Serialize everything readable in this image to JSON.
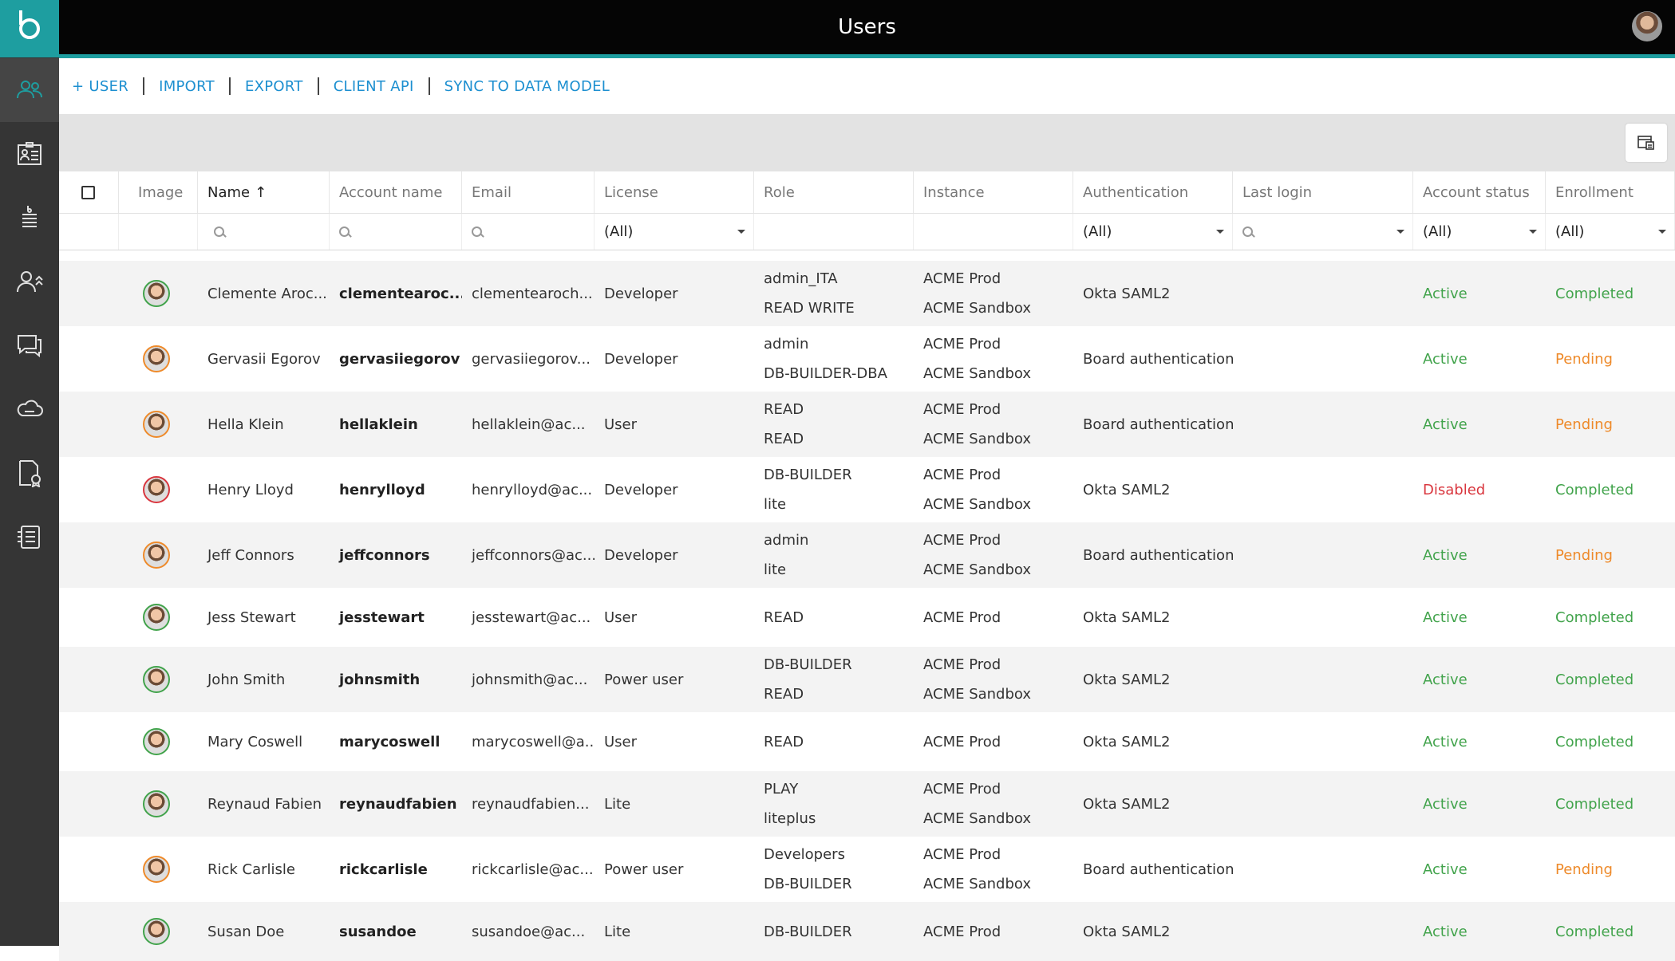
{
  "header": {
    "title": "Users"
  },
  "toolbar": {
    "add_user": "+ USER",
    "import": "IMPORT",
    "export": "EXPORT",
    "client_api": "CLIENT API",
    "sync": "SYNC TO DATA MODEL"
  },
  "sidebar": {
    "items": [
      {
        "icon": "users-icon",
        "active": true
      },
      {
        "icon": "id-card-icon",
        "active": false
      },
      {
        "icon": "database-icon",
        "active": false
      },
      {
        "icon": "user-upgrade-icon",
        "active": false
      },
      {
        "icon": "chat-icon",
        "active": false
      },
      {
        "icon": "cloud-icon",
        "active": false
      },
      {
        "icon": "certificate-icon",
        "active": false
      },
      {
        "icon": "settings-list-icon",
        "active": false
      }
    ]
  },
  "table": {
    "columns": {
      "image": "Image",
      "name": "Name",
      "sort_indicator": "↑",
      "account_name": "Account name",
      "email": "Email",
      "license": "License",
      "role": "Role",
      "instance": "Instance",
      "authentication": "Authentication",
      "last_login": "Last login",
      "account_status": "Account status",
      "enrollment": "Enrollment"
    },
    "filters": {
      "license": "(All)",
      "authentication": "(All)",
      "account_status": "(All)",
      "enrollment": "(All)"
    },
    "rows": [
      {
        "name": "Clemente Aroc...",
        "account": "clementearoc...",
        "email": "clementearoch...",
        "license": "Developer",
        "role1": "admin_ITA",
        "role2": "READ WRITE",
        "inst1": "ACME Prod",
        "inst2": "ACME Sandbox",
        "auth": "Okta SAML2",
        "status": "Active",
        "enroll": "Completed"
      },
      {
        "name": "Gervasii Egorov",
        "account": "gervasiiegorov",
        "email": "gervasiiegorov...",
        "license": "Developer",
        "role1": "admin",
        "role2": "DB-BUILDER-DBA",
        "inst1": "ACME Prod",
        "inst2": "ACME Sandbox",
        "auth": "Board authentication",
        "status": "Active",
        "enroll": "Pending"
      },
      {
        "name": "Hella Klein",
        "account": "hellaklein",
        "email": "hellaklein@ac...",
        "license": "User",
        "role1": "READ",
        "role2": "READ",
        "inst1": "ACME Prod",
        "inst2": "ACME Sandbox",
        "auth": "Board authentication",
        "status": "Active",
        "enroll": "Pending"
      },
      {
        "name": "Henry Lloyd",
        "account": "henrylloyd",
        "email": "henrylloyd@ac...",
        "license": "Developer",
        "role1": "DB-BUILDER",
        "role2": "lite",
        "inst1": "ACME Prod",
        "inst2": "ACME Sandbox",
        "auth": "Okta SAML2",
        "status": "Disabled",
        "enroll": "Completed"
      },
      {
        "name": "Jeff Connors",
        "account": "jeffconnors",
        "email": "jeffconnors@ac...",
        "license": "Developer",
        "role1": "admin",
        "role2": "lite",
        "inst1": "ACME Prod",
        "inst2": "ACME Sandbox",
        "auth": "Board authentication",
        "status": "Active",
        "enroll": "Pending"
      },
      {
        "name": "Jess Stewart",
        "account": "jesstewart",
        "email": "jesstewart@ac...",
        "license": "User",
        "role1": "READ",
        "inst1": "ACME Prod",
        "auth": "Okta SAML2",
        "status": "Active",
        "enroll": "Completed"
      },
      {
        "name": "John Smith",
        "account": "johnsmith",
        "email": "johnsmith@ac...",
        "license": "Power user",
        "role1": "DB-BUILDER",
        "role2": "READ",
        "inst1": "ACME Prod",
        "inst2": "ACME Sandbox",
        "auth": "Okta SAML2",
        "status": "Active",
        "enroll": "Completed"
      },
      {
        "name": "Mary Coswell",
        "account": "marycoswell",
        "email": "marycoswell@a...",
        "license": "User",
        "role1": "READ",
        "inst1": "ACME Prod",
        "auth": "Okta SAML2",
        "status": "Active",
        "enroll": "Completed"
      },
      {
        "name": "Reynaud Fabien",
        "account": "reynaudfabien",
        "email": "reynaudfabien...",
        "license": "Lite",
        "role1": "PLAY",
        "role2": "liteplus",
        "inst1": "ACME Prod",
        "inst2": "ACME Sandbox",
        "auth": "Okta SAML2",
        "status": "Active",
        "enroll": "Completed"
      },
      {
        "name": "Rick Carlisle",
        "account": "rickcarlisle",
        "email": "rickcarlisle@ac...",
        "license": "Power user",
        "role1": "Developers",
        "role2": "DB-BUILDER",
        "inst1": "ACME Prod",
        "inst2": "ACME Sandbox",
        "auth": "Board authentication",
        "status": "Active",
        "enroll": "Pending"
      },
      {
        "name": "Susan Doe",
        "account": "susandoe",
        "email": "susandoe@ac...",
        "license": "Lite",
        "role1": "DB-BUILDER",
        "inst1": "ACME Prod",
        "auth": "Okta SAML2",
        "status": "Active",
        "enroll": "Completed"
      }
    ]
  },
  "colors": {
    "accent": "#1e9ea0",
    "link": "#1c8fd0",
    "green": "#41a34b",
    "orange": "#ee8a2a",
    "red": "#d9363e"
  }
}
